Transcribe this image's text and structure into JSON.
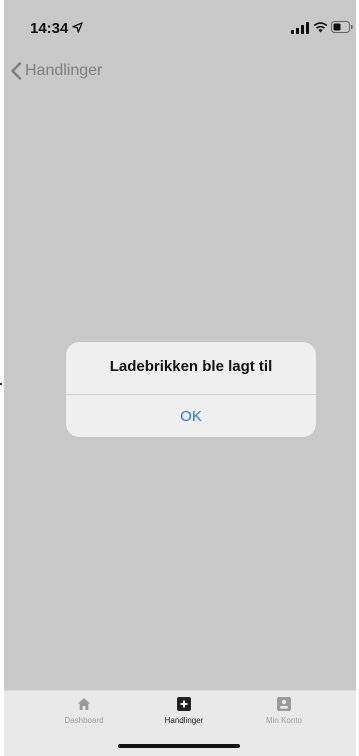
{
  "status_bar": {
    "time": "14:34",
    "location_icon": "location-arrow-icon",
    "signal_icon": "cellular-signal-icon",
    "wifi_icon": "wifi-icon",
    "battery_icon": "battery-icon"
  },
  "nav": {
    "back_label": "Handlinger",
    "back_icon": "chevron-left-icon"
  },
  "alert": {
    "title": "Ladebrikken ble lagt til",
    "ok_label": "OK"
  },
  "tabs": [
    {
      "label": "Dashboard",
      "icon": "home-icon",
      "active": false
    },
    {
      "label": "Handlinger",
      "icon": "plus-square-icon",
      "active": true
    },
    {
      "label": "Min Konto",
      "icon": "account-card-icon",
      "active": false
    }
  ],
  "colors": {
    "accent": "#1e78f0",
    "tab_active": "#222222",
    "tab_inactive": "#9a9a9a"
  }
}
